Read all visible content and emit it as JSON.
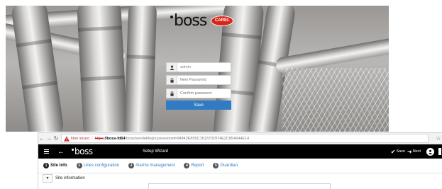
{
  "login": {
    "logo_text": "boss",
    "brand_badge": "CAREL",
    "username_value": "admin",
    "new_password_placeholder": "New Password",
    "confirm_password_placeholder": "Confirm password",
    "save_label": "Save",
    "icons": {
      "username": "user-icon",
      "password": "lock-icon"
    },
    "colors": {
      "save_button": "#2f7bc4",
      "brand_badge": "#d62618"
    }
  },
  "browser": {
    "nav_icons": [
      "back-arrow-icon",
      "forward-arrow-icon",
      "reload-icon"
    ],
    "security_label": "Non sicuro",
    "url_scheme": "https",
    "url_host": "://boss-fd64",
    "url_path": "/boss/servlet/login;jsessionid=94842E855C1613702974E2C854944E14"
  },
  "app": {
    "logo_text": "boss",
    "title": "Setup Wizard",
    "actions": {
      "save": "Save",
      "next": "Next"
    },
    "tabs": [
      {
        "num": "1",
        "label": "Site Info",
        "active": true
      },
      {
        "num": "2",
        "label": "Lines configuration",
        "active": false
      },
      {
        "num": "3",
        "label": "Alarms management",
        "active": false
      },
      {
        "num": "4",
        "label": "Report",
        "active": false
      },
      {
        "num": "5",
        "label": "Guardian",
        "active": false
      }
    ],
    "section_title": "Site information",
    "colors": {
      "accent": "#2f7bc4",
      "app_bar": "#000000"
    }
  }
}
